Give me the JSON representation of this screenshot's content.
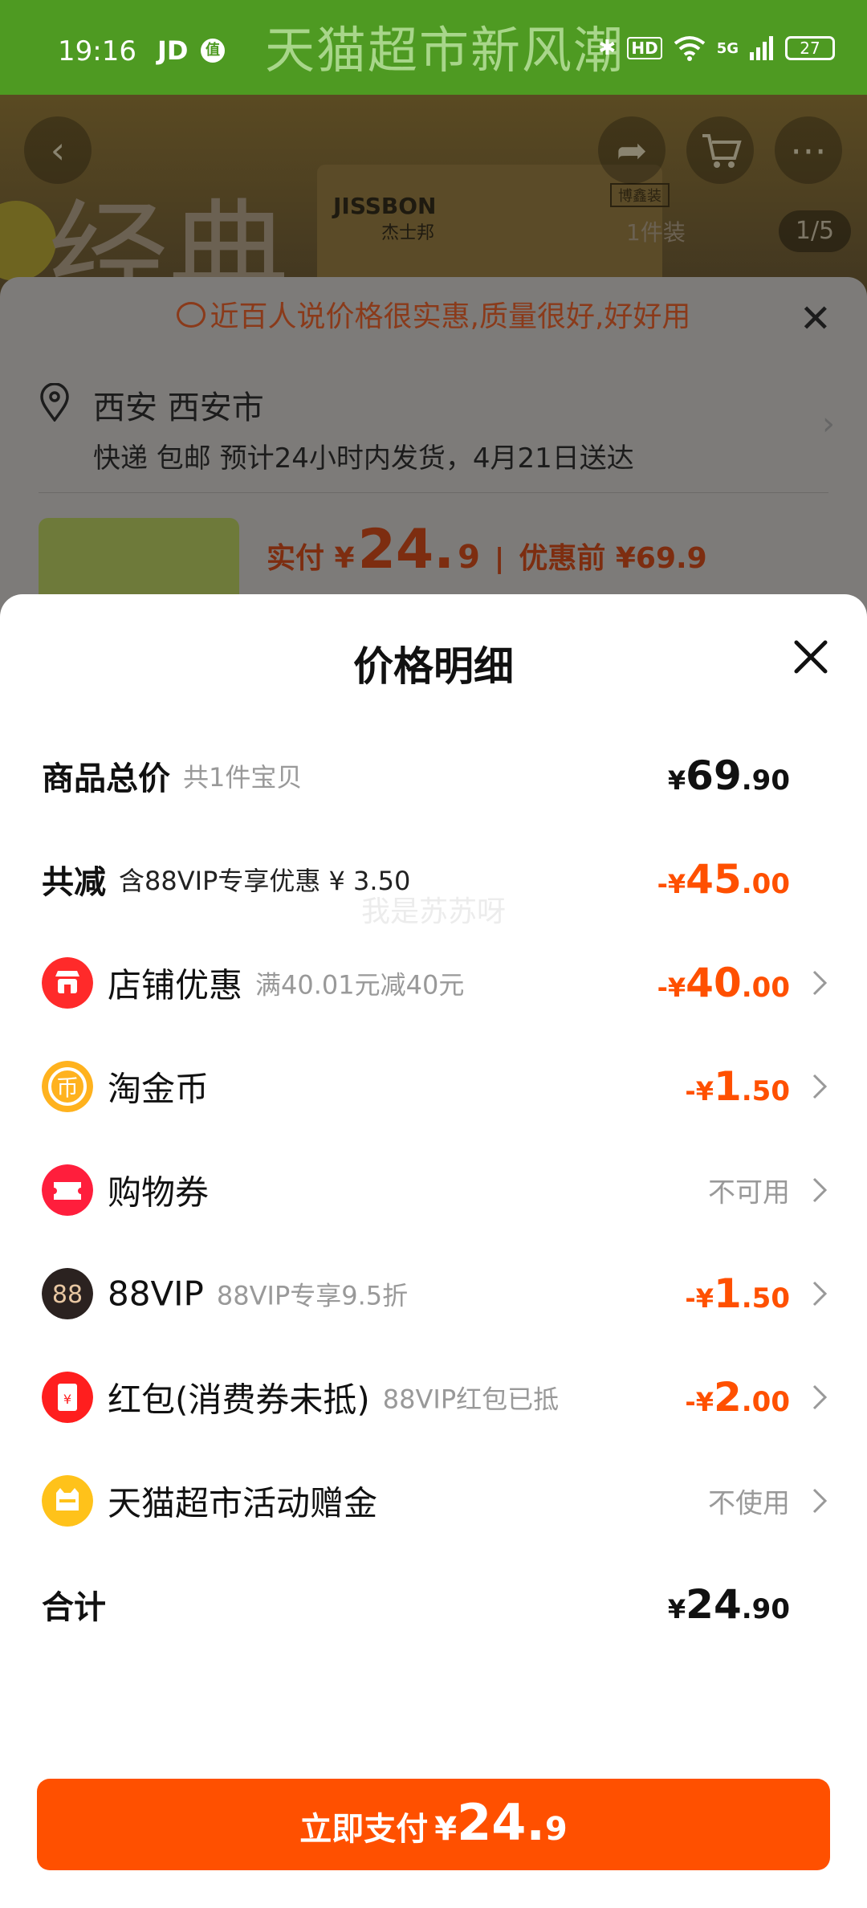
{
  "status_bar": {
    "time": "19:16",
    "app_label": "JD",
    "app_badge": "值",
    "bluetooth": "✱",
    "hd": "HD",
    "signal": "5G",
    "battery": "27"
  },
  "background": {
    "banner_text": "天猫超市新风潮",
    "hero_text": "经典",
    "brand": "JISSBON",
    "brand_cn": "杰士邦",
    "tag_badge": "博鑫装",
    "pack_label": "1件装",
    "pager": "1/5"
  },
  "order_sheet": {
    "notice": "近百人说价格很实惠,质量很好,好好用",
    "location_city": "西安 西安市",
    "shipping": "快递 包邮 预计24小时内发货，4月21日送达",
    "pay_label": "实付 ¥",
    "pay_int": "24.",
    "pay_dec": "9",
    "separator": "|",
    "before_discount": "优惠前 ¥69.9"
  },
  "modal": {
    "title": "价格明细",
    "watermark": "我是苏苏呀",
    "total_price": {
      "label": "商品总价",
      "sub": "共1件宝贝",
      "cur": "¥",
      "int": "69",
      "dec": ".90"
    },
    "reduction": {
      "label": "共减",
      "sub": "含88VIP专享优惠 ¥ 3.50",
      "cur": "-¥",
      "int": "45",
      "dec": ".00"
    },
    "items": [
      {
        "label": "店铺优惠",
        "sub": "满40.01元减40元",
        "cur": "-¥",
        "int": "40",
        "dec": ".00"
      },
      {
        "label": "淘金币",
        "sub": "",
        "cur": "-¥",
        "int": "1",
        "dec": ".50"
      },
      {
        "label": "购物券",
        "sub": "",
        "status": "不可用"
      },
      {
        "label": "88VIP",
        "sub": "88VIP专享9.5折",
        "cur": "-¥",
        "int": "1",
        "dec": ".50"
      },
      {
        "label": "红包(消费券未抵)",
        "sub": "88VIP红包已抵",
        "cur": "-¥",
        "int": "2",
        "dec": ".00"
      },
      {
        "label": "天猫超市活动赠金",
        "sub": "",
        "status": "不使用"
      }
    ],
    "icon_glyphs": {
      "coin": "币",
      "vip": "88",
      "redpacket": "¥"
    },
    "sum": {
      "label": "合计",
      "cur": "¥",
      "int": "24",
      "dec": ".90"
    },
    "pay_button": {
      "label": "立即支付",
      "cur": "¥",
      "int": "24.",
      "dec": "9"
    }
  },
  "colors": {
    "accent": "#ff5000",
    "text": "#111111",
    "muted": "#999999"
  }
}
